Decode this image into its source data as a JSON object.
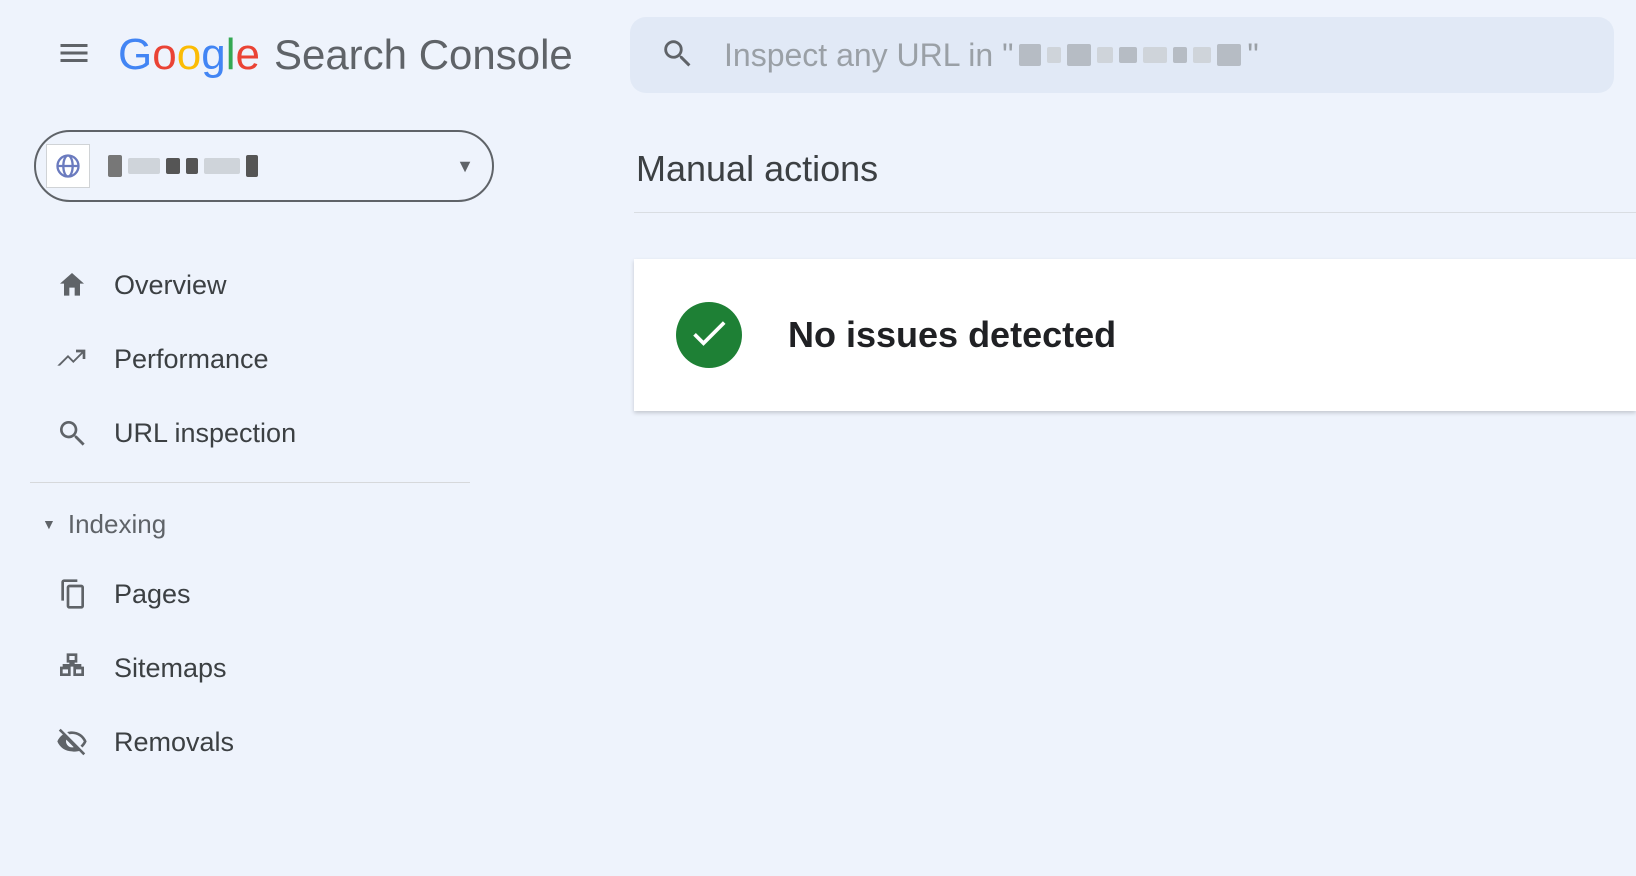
{
  "header": {
    "app_title": "Search Console",
    "search_placeholder_prefix": "Inspect any URL in \"",
    "search_placeholder_suffix": "\""
  },
  "property_selector": {
    "property_name_obscured": true
  },
  "sidebar": {
    "items": [
      {
        "icon": "home",
        "label": "Overview"
      },
      {
        "icon": "trending",
        "label": "Performance"
      },
      {
        "icon": "search",
        "label": "URL inspection"
      }
    ],
    "section_indexing": {
      "label": "Indexing",
      "expanded": true,
      "items": [
        {
          "icon": "pages",
          "label": "Pages"
        },
        {
          "icon": "sitemaps",
          "label": "Sitemaps"
        },
        {
          "icon": "removals",
          "label": "Removals"
        }
      ]
    }
  },
  "main": {
    "page_title": "Manual actions",
    "status": {
      "icon": "check-circle",
      "text": "No issues detected",
      "color": "#1e8035"
    }
  },
  "google_logo_letters": [
    "G",
    "o",
    "o",
    "g",
    "l",
    "e"
  ]
}
